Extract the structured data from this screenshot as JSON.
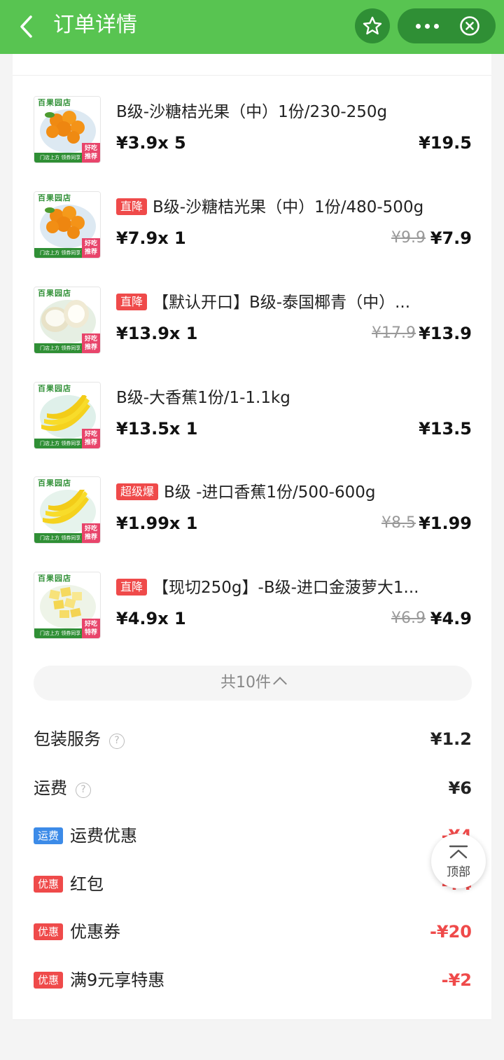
{
  "header": {
    "title": "订单详情",
    "bg_color": "#58c451"
  },
  "items": [
    {
      "name": "B级-沙糖桔光果（中）1份/230-250g",
      "tag": "",
      "price_qty": "¥3.9x  5",
      "old_price": "",
      "total": "¥19.5",
      "fruit": "orange"
    },
    {
      "name": "B级-沙糖桔光果（中）1份/480-500g",
      "tag": "直降",
      "price_qty": "¥7.9x  1",
      "old_price": "¥9.9",
      "total": "¥7.9",
      "fruit": "orange"
    },
    {
      "name": "【默认开口】B级-泰国椰青（中）...",
      "tag": "直降",
      "price_qty": "¥13.9x  1",
      "old_price": "¥17.9",
      "total": "¥13.9",
      "fruit": "coconut"
    },
    {
      "name": "B级-大香蕉1份/1-1.1kg",
      "tag": "",
      "price_qty": "¥13.5x  1",
      "old_price": "",
      "total": "¥13.5",
      "fruit": "banana"
    },
    {
      "name": "B级 -进口香蕉1份/500-600g",
      "tag": "超级爆",
      "price_qty": "¥1.99x  1",
      "old_price": "¥8.5",
      "total": "¥1.99",
      "fruit": "banana2"
    },
    {
      "name": "【现切250g】-B级-进口金菠萝大1...",
      "tag": "直降",
      "price_qty": "¥4.9x  1",
      "old_price": "¥6.9",
      "total": "¥4.9",
      "fruit": "pineapple"
    }
  ],
  "thumb": {
    "brand": "百果园店",
    "brand_alt": "百果园店",
    "bar_text": "门店上方  领券同享",
    "ribbon": "好吃推荐",
    "ribbon_alt": "好吃特荐"
  },
  "collapse": {
    "label": "共10件"
  },
  "fees": [
    {
      "label": "包装服务",
      "badge": "",
      "help": true,
      "value": "¥1.2",
      "value_red": false
    },
    {
      "label": "运费",
      "badge": "",
      "help": true,
      "value": "¥6",
      "value_red": false
    },
    {
      "label": "运费优惠",
      "badge": "运费",
      "badge_color": "blue",
      "help": false,
      "value": "-¥4",
      "value_red": true
    },
    {
      "label": "红包",
      "badge": "优惠",
      "badge_color": "red",
      "help": false,
      "value": "-¥4",
      "value_red": true
    },
    {
      "label": "优惠券",
      "badge": "优惠",
      "badge_color": "red",
      "help": false,
      "value": "-¥20",
      "value_red": true
    },
    {
      "label": "满9元享特惠",
      "badge": "优惠",
      "badge_color": "red",
      "help": false,
      "value": "-¥2",
      "value_red": true
    }
  ],
  "top_button": {
    "label": "顶部"
  },
  "help_glyph": "?"
}
